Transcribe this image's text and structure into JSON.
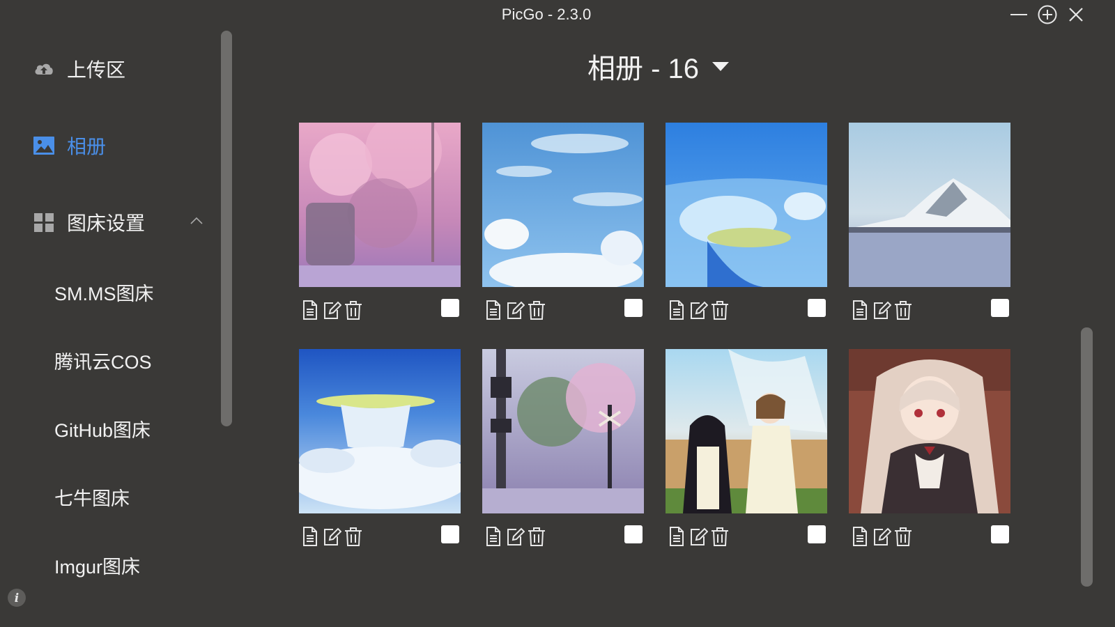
{
  "window": {
    "title": "PicGo - 2.3.0"
  },
  "sidebar": {
    "items": [
      {
        "label": "上传区",
        "icon": "cloud-upload-icon"
      },
      {
        "label": "相册",
        "icon": "image-icon",
        "active": true
      },
      {
        "label": "图床设置",
        "icon": "grid-icon",
        "expanded": true
      }
    ],
    "sub_items": [
      "SM.MS图床",
      "腾讯云COS",
      "GitHub图床",
      "七牛图床",
      "Imgur图床"
    ]
  },
  "gallery": {
    "title": "相册 - 16",
    "images": [
      {
        "name": "cherry-blossom-railway",
        "checked": false
      },
      {
        "name": "blue-sky-clouds",
        "checked": false
      },
      {
        "name": "sky-island-aerial",
        "checked": false
      },
      {
        "name": "snowy-mountain-sea",
        "checked": false
      },
      {
        "name": "cloud-sea-island",
        "checked": false
      },
      {
        "name": "railway-crossing-sakura",
        "checked": false
      },
      {
        "name": "anime-girls-garden",
        "checked": false
      },
      {
        "name": "anime-maid-girl",
        "checked": false
      }
    ]
  },
  "colors": {
    "background": "#3a3937",
    "accent": "#4a8fe8",
    "text": "#f2f2f2",
    "scrollbar": "#6e6d6b"
  }
}
